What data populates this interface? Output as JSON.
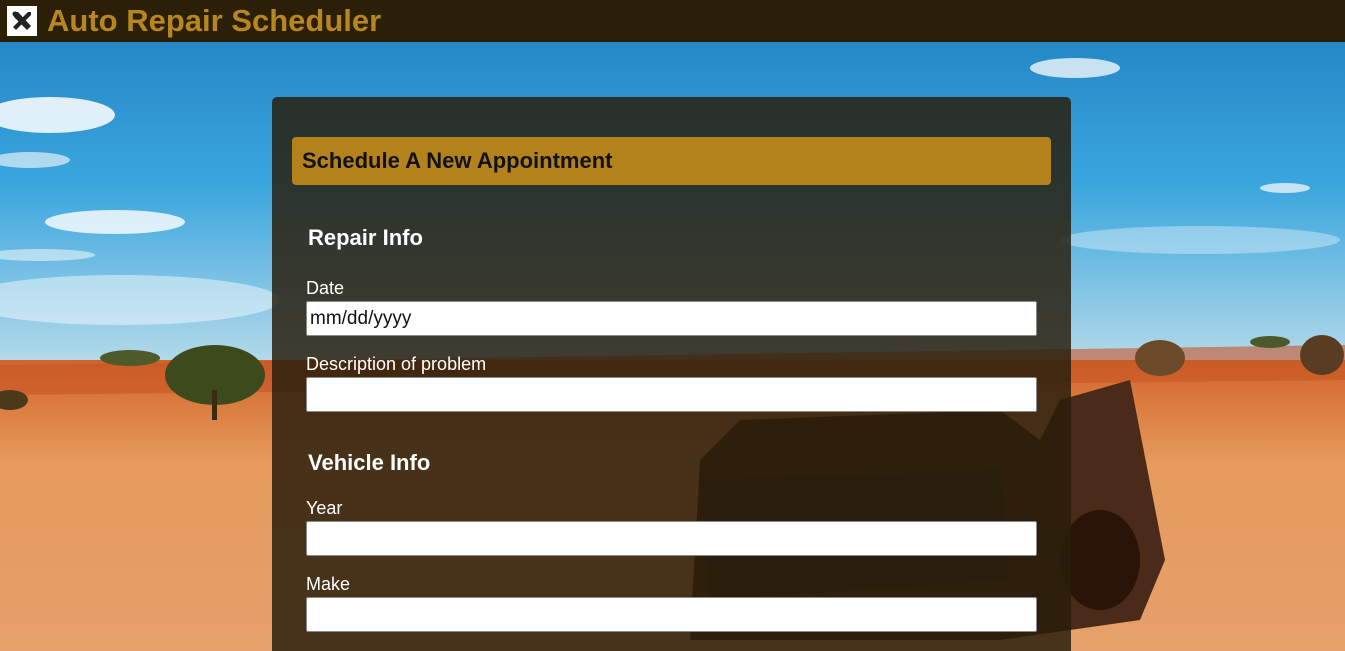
{
  "app": {
    "title": "Auto Repair Scheduler",
    "logo_icon": "wrench-screwdriver-icon"
  },
  "colors": {
    "header_bg": "#2b1f08",
    "title": "#b7861f",
    "accent": "#b4821b",
    "panel_bg": "rgba(40,30,12,0.84)"
  },
  "form": {
    "heading": "Schedule A New Appointment",
    "sections": {
      "repair": {
        "title": "Repair Info",
        "date_label": "Date",
        "date_placeholder": "mm/dd/yyyy",
        "description_label": "Description of problem",
        "description_value": ""
      },
      "vehicle": {
        "title": "Vehicle Info",
        "year_label": "Year",
        "year_value": "",
        "make_label": "Make",
        "make_value": ""
      }
    }
  }
}
